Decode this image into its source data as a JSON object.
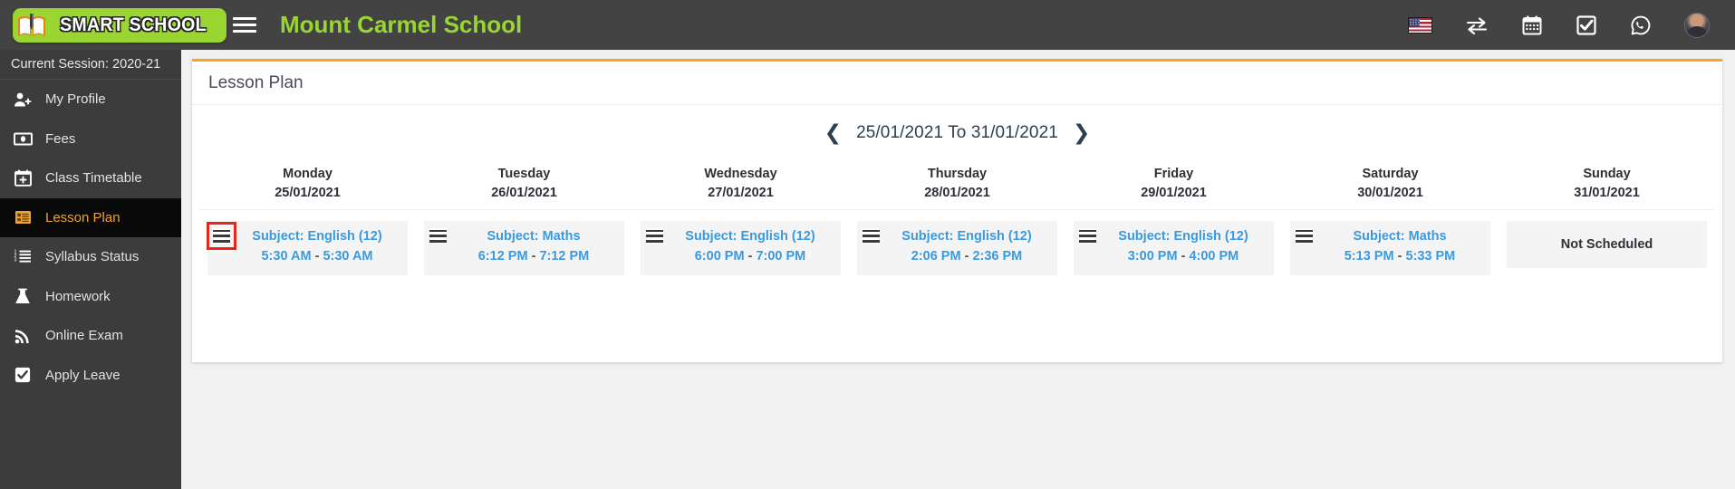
{
  "topbar": {
    "logo_text": "SMART SCHOOL",
    "logo_icon": "open-book-icon",
    "menu_toggle_icon": "hamburger-menu-icon",
    "school_title": "Mount Carmel School",
    "icons": [
      {
        "name": "language-flag-icon",
        "label": "US"
      },
      {
        "name": "switch-exchange-icon",
        "label": "Switch"
      },
      {
        "name": "calendar-icon",
        "label": "Calendar"
      },
      {
        "name": "checkbox-task-icon",
        "label": "Tasks"
      },
      {
        "name": "whatsapp-icon",
        "label": "WhatsApp"
      },
      {
        "name": "user-avatar",
        "label": "Profile"
      }
    ]
  },
  "sidebar": {
    "session_label": "Current Session: 2020-21",
    "items": [
      {
        "label": "My Profile",
        "icon": "user-add-icon",
        "active": false
      },
      {
        "label": "Fees",
        "icon": "money-bill-icon",
        "active": false
      },
      {
        "label": "Class Timetable",
        "icon": "calendar-plus-icon",
        "active": false
      },
      {
        "label": "Lesson Plan",
        "icon": "list-box-icon",
        "active": true
      },
      {
        "label": "Syllabus Status",
        "icon": "ordered-list-icon",
        "active": false
      },
      {
        "label": "Homework",
        "icon": "flask-icon",
        "active": false
      },
      {
        "label": "Online Exam",
        "icon": "rss-signal-icon",
        "active": false
      },
      {
        "label": "Apply Leave",
        "icon": "check-square-icon",
        "active": false
      }
    ]
  },
  "main": {
    "card_title": "Lesson Plan",
    "week_prev_icon": "chevron-left-icon",
    "week_next_icon": "chevron-right-icon",
    "week_range": "25/01/2021 To 31/01/2021",
    "days": [
      {
        "day": "Monday",
        "date": "25/01/2021",
        "scheduled": true,
        "menu_icon": "hamburger-menu-icon",
        "highlighted": true,
        "subject": "Subject: English (12)",
        "start_time": "5:30 AM",
        "end_time": "5:30 AM"
      },
      {
        "day": "Tuesday",
        "date": "26/01/2021",
        "scheduled": true,
        "menu_icon": "hamburger-menu-icon",
        "highlighted": false,
        "subject": "Subject: Maths",
        "start_time": "6:12 PM",
        "end_time": "7:12 PM"
      },
      {
        "day": "Wednesday",
        "date": "27/01/2021",
        "scheduled": true,
        "menu_icon": "hamburger-menu-icon",
        "highlighted": false,
        "subject": "Subject: English (12)",
        "start_time": "6:00 PM",
        "end_time": "7:00 PM"
      },
      {
        "day": "Thursday",
        "date": "28/01/2021",
        "scheduled": true,
        "menu_icon": "hamburger-menu-icon",
        "highlighted": false,
        "subject": "Subject: English (12)",
        "start_time": "2:06 PM",
        "end_time": "2:36 PM"
      },
      {
        "day": "Friday",
        "date": "29/01/2021",
        "scheduled": true,
        "menu_icon": "hamburger-menu-icon",
        "highlighted": false,
        "subject": "Subject: English (12)",
        "start_time": "3:00 PM",
        "end_time": "4:00 PM"
      },
      {
        "day": "Saturday",
        "date": "30/01/2021",
        "scheduled": true,
        "menu_icon": "hamburger-menu-icon",
        "highlighted": false,
        "subject": "Subject: Maths",
        "start_time": "5:13 PM",
        "end_time": "5:33 PM"
      },
      {
        "day": "Sunday",
        "date": "31/01/2021",
        "scheduled": false,
        "menu_icon": null,
        "highlighted": false,
        "empty_text": "Not Scheduled"
      }
    ],
    "time_separator": "-"
  },
  "colors": {
    "topbar_bg": "#434343",
    "sidebar_bg": "#3c3c3c",
    "sidebar_active_bg": "#0a0a0a",
    "sidebar_active_text": "#f0a22e",
    "brand_green": "#9ad531",
    "card_accent": "#f5a623",
    "lesson_link": "#3a9ae0",
    "highlight_outline": "#e8241f",
    "page_bg": "#f1f1f1"
  }
}
